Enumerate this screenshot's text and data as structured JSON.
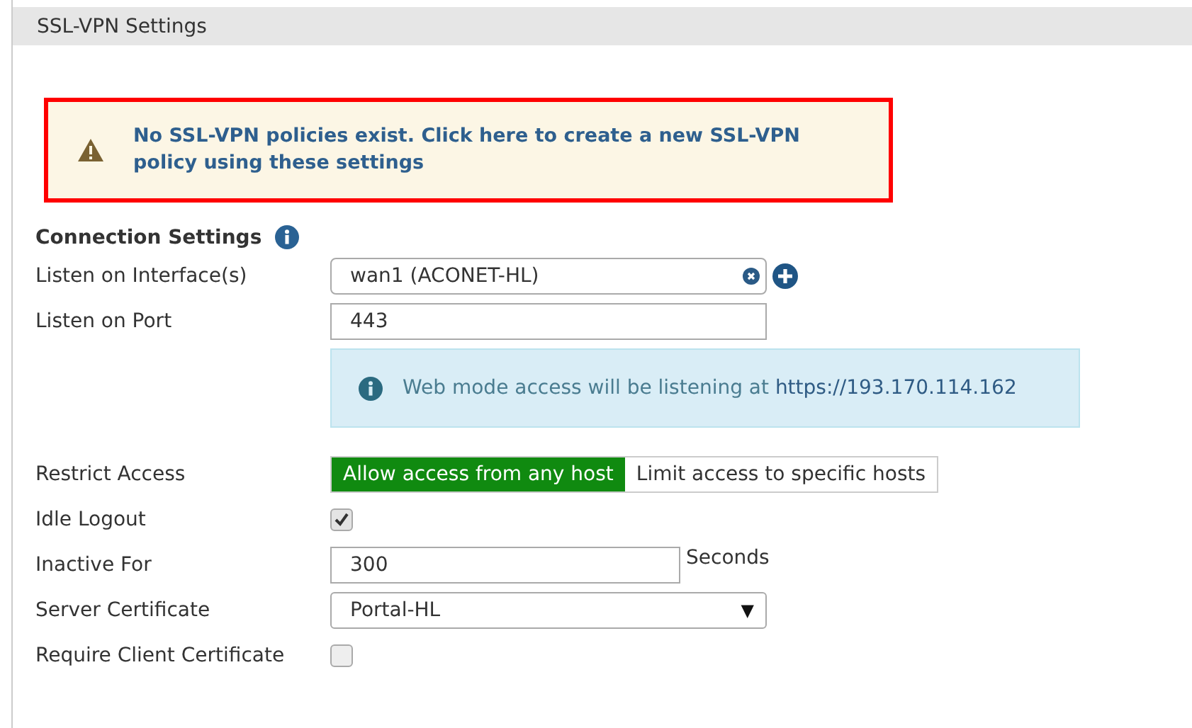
{
  "header": {
    "title": "SSL-VPN Settings"
  },
  "warning": {
    "text": "No SSL-VPN policies exist. Click here to create a new SSL-VPN policy using these settings"
  },
  "section": {
    "title": "Connection Settings"
  },
  "interface": {
    "label": "Listen on Interface(s)",
    "value": "wan1 (ACONET-HL)"
  },
  "port": {
    "label": "Listen on Port",
    "value": "443"
  },
  "info": {
    "text": "Web mode access will be listening at",
    "url": "https://193.170.114.162"
  },
  "restrict": {
    "label": "Restrict Access",
    "options": [
      {
        "label": "Allow access from any host",
        "selected": true
      },
      {
        "label": "Limit access to specific hosts",
        "selected": false
      }
    ]
  },
  "idle_logout": {
    "label": "Idle Logout",
    "checked": true
  },
  "inactive": {
    "label": "Inactive For",
    "value": "300",
    "unit": "Seconds"
  },
  "server_cert": {
    "label": "Server Certificate",
    "value": "Portal-HL",
    "arrow": "▼"
  },
  "client_cert": {
    "label": "Require Client Certificate",
    "checked": false
  }
}
